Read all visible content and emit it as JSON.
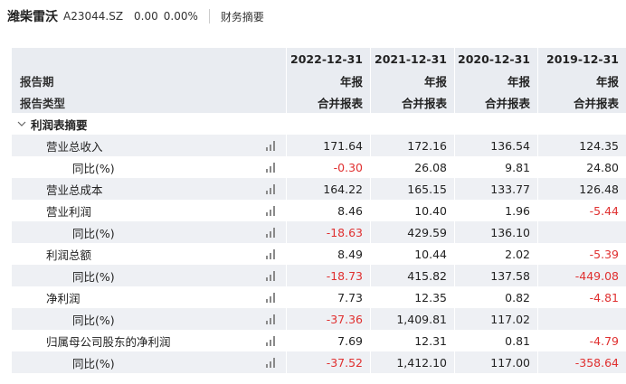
{
  "header": {
    "stock_name": "潍柴雷沃",
    "stock_code": "A23044.SZ",
    "price": "0.00",
    "change_pct": "0.00%",
    "tab_label": "财务摘要"
  },
  "table": {
    "period_label": "报告期",
    "type_label": "报告类型",
    "columns": [
      {
        "date": "2022-12-31",
        "period": "年报",
        "type": "合并报表"
      },
      {
        "date": "2021-12-31",
        "period": "年报",
        "type": "合并报表"
      },
      {
        "date": "2020-12-31",
        "period": "年报",
        "type": "合并报表"
      },
      {
        "date": "2019-12-31",
        "period": "年报",
        "type": "合并报表"
      }
    ],
    "section_title": "利润表摘要",
    "rows": [
      {
        "label": "营业总收入",
        "values": [
          "171.64",
          "172.16",
          "136.54",
          "124.35"
        ]
      },
      {
        "label": "同比(%)",
        "values": [
          "-0.30",
          "26.08",
          "9.81",
          "24.80"
        ]
      },
      {
        "label": "营业总成本",
        "values": [
          "164.22",
          "165.15",
          "133.77",
          "126.48"
        ]
      },
      {
        "label": "营业利润",
        "values": [
          "8.46",
          "10.40",
          "1.96",
          "-5.44"
        ]
      },
      {
        "label": "同比(%)",
        "values": [
          "-18.63",
          "429.59",
          "136.10",
          ""
        ]
      },
      {
        "label": "利润总额",
        "values": [
          "8.49",
          "10.44",
          "2.02",
          "-5.39"
        ]
      },
      {
        "label": "同比(%)",
        "values": [
          "-18.73",
          "415.82",
          "137.58",
          "-449.08"
        ]
      },
      {
        "label": "净利润",
        "values": [
          "7.73",
          "12.35",
          "0.82",
          "-4.81"
        ]
      },
      {
        "label": "同比(%)",
        "values": [
          "-37.36",
          "1,409.81",
          "117.02",
          ""
        ]
      },
      {
        "label": "归属母公司股东的净利润",
        "values": [
          "7.69",
          "12.31",
          "0.81",
          "-4.79"
        ]
      },
      {
        "label": "同比(%)",
        "values": [
          "-37.52",
          "1,412.10",
          "117.00",
          "-358.64"
        ]
      }
    ]
  },
  "colors": {
    "negative": "#e03030",
    "header_bg": "#e9ecf1",
    "row_alt_bg": "#eef0f4"
  },
  "icons": [
    "chevron-down-icon",
    "bar-chart-icon"
  ]
}
